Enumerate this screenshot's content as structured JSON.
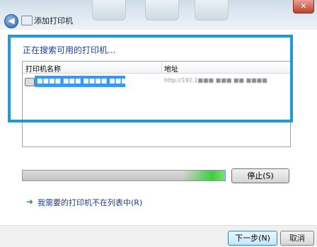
{
  "window": {
    "title": "添加打印机",
    "close_label": "✕"
  },
  "header": {
    "searching_text": "正在搜索可用的打印机..."
  },
  "printer_list": {
    "columns": [
      "打印机名称",
      "地址"
    ],
    "rows": [
      {
        "name": "■■■■ ■■■ ■■■■ ■■■■",
        "address": "http://192.1■■■ ■■■ ■■ ■■■■"
      }
    ]
  },
  "progress": {
    "value": 1.0
  },
  "actions": {
    "stop_label": "停止(S)",
    "not_listed_link": "我需要的打印机不在列表中(R)",
    "next_label": "下一步(N)",
    "cancel_label": "取消"
  },
  "colors": {
    "highlight": "#1e9ad6",
    "selection": "#3399ff",
    "progress_glow": "#3fce3f"
  }
}
